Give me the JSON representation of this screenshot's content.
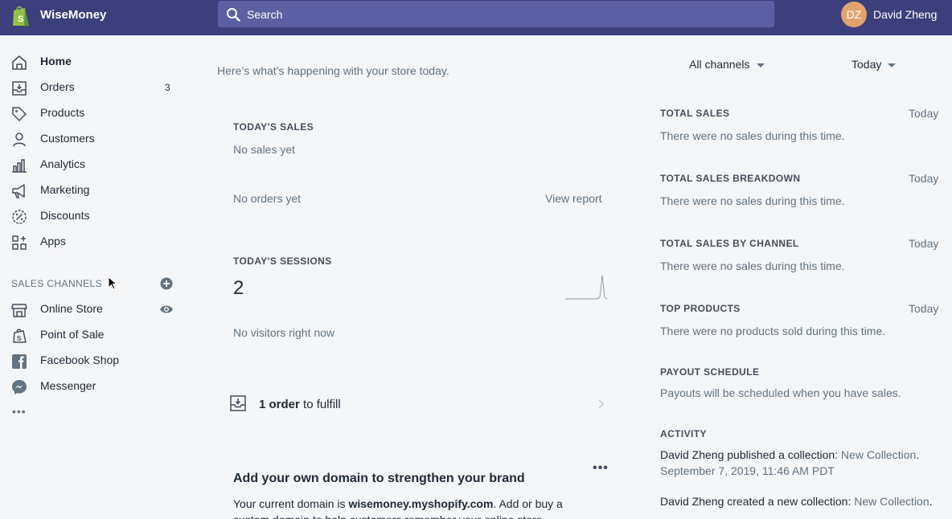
{
  "topbar": {
    "brand": "WiseMoney",
    "search_placeholder": "Search",
    "avatar_initials": "DZ",
    "user_name": "David Zheng"
  },
  "sidebar": {
    "items": [
      {
        "label": "Home",
        "icon": "home-icon"
      },
      {
        "label": "Orders",
        "icon": "orders-icon",
        "count": "3"
      },
      {
        "label": "Products",
        "icon": "tag-icon"
      },
      {
        "label": "Customers",
        "icon": "person-icon"
      },
      {
        "label": "Analytics",
        "icon": "bar-chart-icon"
      },
      {
        "label": "Marketing",
        "icon": "megaphone-icon"
      },
      {
        "label": "Discounts",
        "icon": "discount-icon"
      },
      {
        "label": "Apps",
        "icon": "apps-icon"
      }
    ],
    "channels_header": "SALES CHANNELS",
    "channels": [
      {
        "label": "Online Store",
        "icon": "store-icon"
      },
      {
        "label": "Point of Sale",
        "icon": "shopping-bag-icon"
      },
      {
        "label": "Facebook Shop",
        "icon": "facebook-icon"
      },
      {
        "label": "Messenger",
        "icon": "messenger-icon"
      }
    ],
    "more": "•••"
  },
  "main": {
    "intro": "Here’s what’s happening with your store today.",
    "sales_header": "TODAY'S SALES",
    "no_sales": "No sales yet",
    "no_orders": "No orders yet",
    "view_report": "View report",
    "sessions_header": "TODAY'S SESSIONS",
    "sessions_value": "2",
    "no_visitors": "No visitors right now",
    "fulfill_count": "1 order",
    "fulfill_suffix": " to fulfill",
    "domain_title": "Add your own domain to strengthen your brand",
    "domain_more": "•••",
    "domain_text_1": "Your current domain is ",
    "domain_name": "wisemoney.myshopify.com",
    "domain_text_2": ". Add or buy a custom domain to help customers remember your online store."
  },
  "right": {
    "channel_filter": "All channels",
    "date_filter": "Today",
    "sections": [
      {
        "header": "TOTAL SALES",
        "period": "Today",
        "text": "There were no sales during this time."
      },
      {
        "header": "TOTAL SALES BREAKDOWN",
        "period": "Today",
        "text": "There were no sales during this time."
      },
      {
        "header": "TOTAL SALES BY CHANNEL",
        "period": "Today",
        "text": "There were no sales during this time."
      },
      {
        "header": "TOP PRODUCTS",
        "period": "Today",
        "text": "There were no products sold during this time."
      },
      {
        "header": "PAYOUT SCHEDULE",
        "text": "Payouts will be scheduled when you have sales."
      }
    ],
    "activity_header": "ACTIVITY",
    "activity": [
      {
        "text": "David Zheng published a collection: ",
        "link": "New Collection",
        "suffix": ".",
        "time": "September 7, 2019, 11:46 AM PDT"
      },
      {
        "text": "David Zheng created a new collection: ",
        "link": "New Collection",
        "suffix": "."
      }
    ]
  },
  "colors": {
    "topbar": "#3d3f7d",
    "search": "#5d5fa4",
    "avatar": "#e1a46e",
    "logo": "#95bf47"
  }
}
